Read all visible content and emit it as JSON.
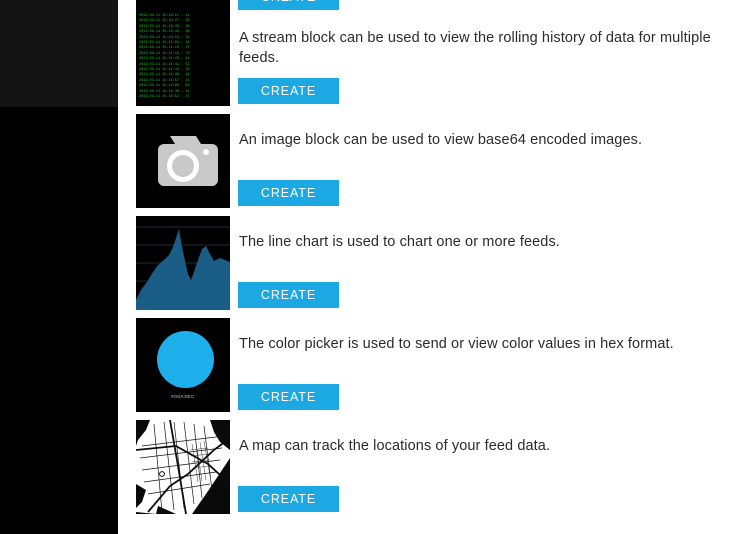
{
  "sidebar": {
    "upper_color": "#141414",
    "lower_color": "#000000"
  },
  "theme": {
    "accent": "#1ca9e3",
    "page_background": "#ffffff",
    "text_color": "#2b2b2b",
    "thumb_background": "#000000"
  },
  "blocks": [
    {
      "id": "clipped-top",
      "thumb": "clipped-thumbnail",
      "description": "",
      "create_label": "CREATE"
    },
    {
      "id": "stream",
      "thumb": "stream-thumbnail",
      "description": "A stream block can be used to view the rolling history of data for multiple feeds.",
      "create_label": "CREATE",
      "stream_lines": "2013-03-11 15:10:17 - 21\n2013-03-11 15:10:27 - 23\n2013-03-11 15:10:35 - 30\n2013-03-11 15:10:44 - 38\n2013-03-11 15:10:53 - 34\n2013-03-11 15:11:02 - 18\n2013-03-11 15:11:10 - 27\n2013-03-11 15:11:19 - 74\n2013-03-11 15:11:28 - 44\n2013-03-11 15:11:41 - 52\n2013-03-11 15:11:44 - 33\n2013-03-11 15:11:48 - 19\n2013-03-11 15:11:57 - 11\n2013-03-11 15:12:09 - 83\n2013-03-11 15:12:38 - 31\n2013-03-11 15:12:52 - 27"
    },
    {
      "id": "image",
      "thumb": "camera-icon",
      "description": "An image block can be used to view base64 encoded images.",
      "create_label": "CREATE"
    },
    {
      "id": "line-chart",
      "thumb": "line-chart-thumbnail",
      "description": "The line chart is used to chart one or more feeds.",
      "create_label": "CREATE"
    },
    {
      "id": "color-picker",
      "thumb": "color-swatch-thumbnail",
      "description": "The color picker is used to send or view color values in hex format.",
      "create_label": "CREATE",
      "swatch_color": "#1eb0ec",
      "swatch_hex_label": "#00A3EC"
    },
    {
      "id": "map",
      "thumb": "map-thumbnail",
      "description": "A map can track the locations of your feed data.",
      "create_label": "CREATE"
    }
  ]
}
